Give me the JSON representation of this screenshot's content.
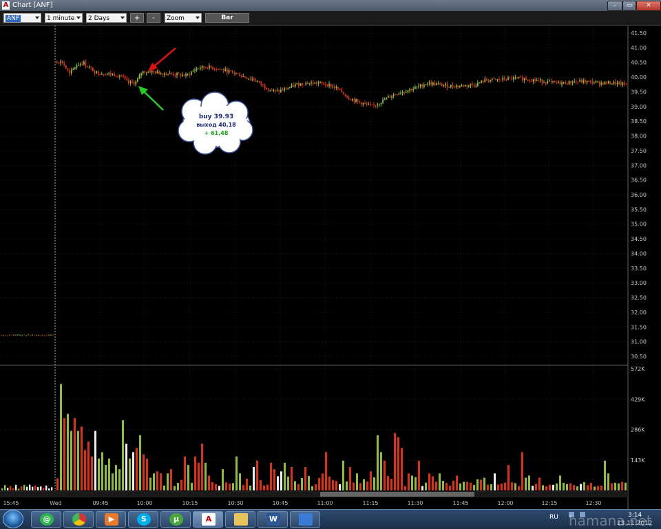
{
  "window": {
    "title": "Chart [ANF]",
    "app_icon_letter": "A",
    "minimize_label": "–",
    "restore_label": "▭",
    "close_label": "✕"
  },
  "toolbar": {
    "symbol": "ANF",
    "interval": "1 minute",
    "range": "2 Days",
    "plus_label": "+",
    "minus_label": "-",
    "zoom": "Zoom",
    "bar_label": "Bar"
  },
  "annotation": {
    "line1": "buy 39.93",
    "line2": "выход 40,18",
    "line3": "+ 61,48"
  },
  "chart_data": {
    "type": "candlestick",
    "price_ticks": [
      "41.50",
      "41.00",
      "40.50",
      "40.00",
      "39.50",
      "39.00",
      "38.50",
      "38.00",
      "37.50",
      "37.00",
      "36.50",
      "36.00",
      "35.50",
      "35.00",
      "34.50",
      "34.00",
      "33.50",
      "33.00",
      "32.50",
      "32.00",
      "31.50",
      "31.00",
      "30.50"
    ],
    "volume_ticks": [
      "572K",
      "429K",
      "286K",
      "143K"
    ],
    "time_labels": [
      "15:45",
      "Wed",
      "09:45",
      "10:00",
      "10:15",
      "10:30",
      "10:45",
      "11:00",
      "11:15",
      "11:30",
      "11:45",
      "12:00",
      "12:15",
      "12:30"
    ],
    "price_path": [
      [
        80,
        40.55
      ],
      [
        90,
        40.5
      ],
      [
        100,
        40.1
      ],
      [
        110,
        40.4
      ],
      [
        120,
        40.5
      ],
      [
        130,
        40.3
      ],
      [
        140,
        40.15
      ],
      [
        160,
        40.1
      ],
      [
        175,
        40.05
      ],
      [
        185,
        39.8
      ],
      [
        195,
        39.8
      ],
      [
        200,
        39.93
      ],
      [
        205,
        40.18
      ],
      [
        215,
        40.2
      ],
      [
        230,
        40.15
      ],
      [
        250,
        40.1
      ],
      [
        270,
        40.05
      ],
      [
        285,
        40.3
      ],
      [
        300,
        40.35
      ],
      [
        320,
        40.25
      ],
      [
        340,
        40.15
      ],
      [
        355,
        40.0
      ],
      [
        370,
        39.9
      ],
      [
        385,
        39.65
      ],
      [
        400,
        39.5
      ],
      [
        415,
        39.6
      ],
      [
        430,
        39.75
      ],
      [
        445,
        39.8
      ],
      [
        460,
        39.8
      ],
      [
        475,
        39.75
      ],
      [
        490,
        39.6
      ],
      [
        505,
        39.3
      ],
      [
        520,
        39.15
      ],
      [
        540,
        39.0
      ],
      [
        555,
        39.2
      ],
      [
        570,
        39.4
      ],
      [
        590,
        39.55
      ],
      [
        605,
        39.65
      ],
      [
        620,
        39.8
      ],
      [
        635,
        39.75
      ],
      [
        650,
        39.7
      ],
      [
        670,
        39.7
      ],
      [
        690,
        39.75
      ],
      [
        705,
        39.9
      ],
      [
        720,
        39.9
      ],
      [
        740,
        39.95
      ],
      [
        760,
        39.95
      ],
      [
        775,
        39.9
      ],
      [
        790,
        39.85
      ],
      [
        805,
        39.8
      ],
      [
        820,
        39.8
      ],
      [
        835,
        39.85
      ],
      [
        850,
        39.85
      ],
      [
        870,
        39.8
      ],
      [
        890,
        39.8
      ],
      [
        905,
        39.75
      ]
    ],
    "prev_day_price": 31.22,
    "volume_peak": 520
  }
}
